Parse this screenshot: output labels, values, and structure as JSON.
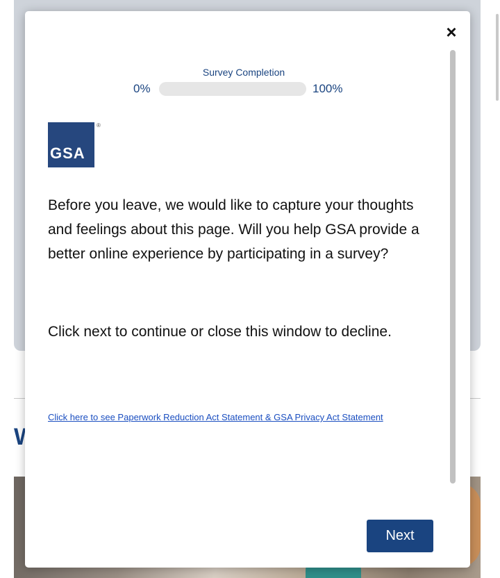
{
  "background": {
    "heading_fragment": "W"
  },
  "modal": {
    "close_label": "×",
    "progress": {
      "label": "Survey Completion",
      "min_label": "0%",
      "max_label": "100%",
      "value_percent": 0
    },
    "logo": {
      "text": "GSA",
      "registered_mark": "®"
    },
    "intro_text": "Before you leave, we would like to capture your thoughts and feelings about this page. Will you help GSA provide a better online experience by participating in a survey?",
    "instruction_text": "Click next to continue or close this window to decline.",
    "privacy_link_text": "Click here to see Paperwork Reduction Act Statement & GSA Privacy Act Statement",
    "next_label": "Next"
  },
  "colors": {
    "brand_blue": "#1a4480",
    "logo_blue": "#26477e",
    "link_blue": "#1a4ec0",
    "progress_track": "#e6e6e6"
  }
}
